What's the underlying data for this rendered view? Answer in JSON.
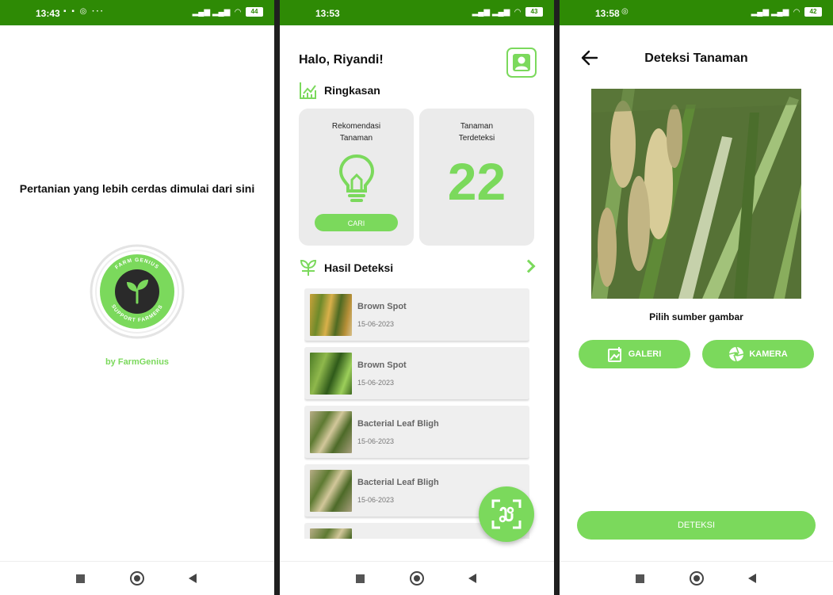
{
  "screens": [
    {
      "status": {
        "time": "13:43",
        "battery": "44"
      },
      "tagline": "Pertanian yang lebih cerdas dimulai dari sini",
      "logo": {
        "ring_top": "FARM GENIUS",
        "ring_bottom": "SUPPORT FARMERS",
        "icon": "sprout-icon"
      },
      "by": "by FarmGenius"
    },
    {
      "status": {
        "time": "13:53",
        "battery": "43"
      },
      "greeting": "Halo, Riyandi!",
      "summary": {
        "title": "Ringkasan",
        "recommend_label_1": "Rekomendasi",
        "recommend_label_2": "Tanaman",
        "search_button": "CARI",
        "detected_label_1": "Tanaman",
        "detected_label_2": "Terdeteksi",
        "detected_count": "22"
      },
      "results": {
        "title": "Hasil Deteksi",
        "items": [
          {
            "name": "Brown Spot",
            "date": "15-06-2023",
            "thumb": "t-brown"
          },
          {
            "name": "Brown Spot",
            "date": "15-06-2023",
            "thumb": "t-green"
          },
          {
            "name": "Bacterial Leaf Bligh",
            "date": "15-06-2023",
            "thumb": "t-rice"
          },
          {
            "name": "Bacterial Leaf Bligh",
            "date": "15-06-2023",
            "thumb": "t-rice"
          },
          {
            "name": "",
            "date": "",
            "thumb": "t-rice"
          }
        ]
      }
    },
    {
      "status": {
        "time": "13:58",
        "battery": "42"
      },
      "title": "Deteksi Tanaman",
      "source_label": "Pilih sumber gambar",
      "gallery_button": "GALERI",
      "camera_button": "KAMERA",
      "detect_button": "DETEKSI"
    }
  ],
  "colors": {
    "status_bar": "#2e8a05",
    "accent": "#7bd95c",
    "card": "#ebebeb"
  }
}
